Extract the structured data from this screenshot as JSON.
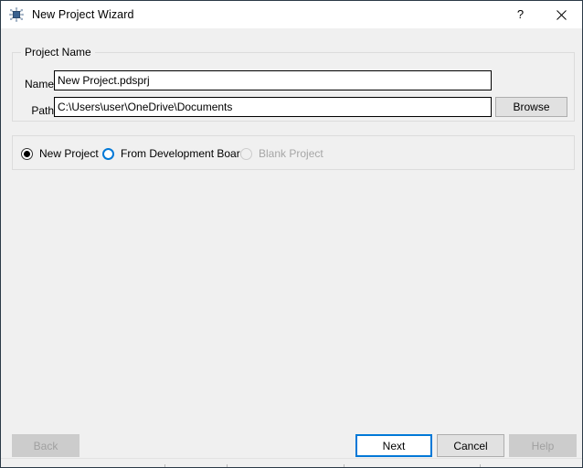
{
  "window": {
    "title": "New Project Wizard",
    "icon": "proteus-chip-icon",
    "accent_color": "#0078d7",
    "background_color": "#f0f0f0",
    "titlebar_color": "#ffffff",
    "border_color": "#2b3a47"
  },
  "titlebar_buttons": [
    {
      "name": "help-button",
      "glyph": "?"
    },
    {
      "name": "close-button",
      "glyph": "✕"
    }
  ],
  "groups": {
    "project_name": {
      "legend": "Project Name",
      "fields": [
        {
          "label": "Name",
          "value": "New Project.pdsprj",
          "placeholder": ""
        },
        {
          "label": "Path",
          "value": "C:\\Users\\user\\OneDrive\\Documents",
          "placeholder": ""
        }
      ],
      "browse_label": "Browse"
    },
    "project_type": {
      "options": [
        {
          "label": "New Project",
          "state": "checked"
        },
        {
          "label": "From Development Board",
          "state": "hover"
        },
        {
          "label": "Blank Project",
          "state": "disabled"
        }
      ]
    }
  },
  "footer": {
    "back_label": "Back",
    "next_label": "Next",
    "cancel_label": "Cancel",
    "help_label": "Help"
  }
}
